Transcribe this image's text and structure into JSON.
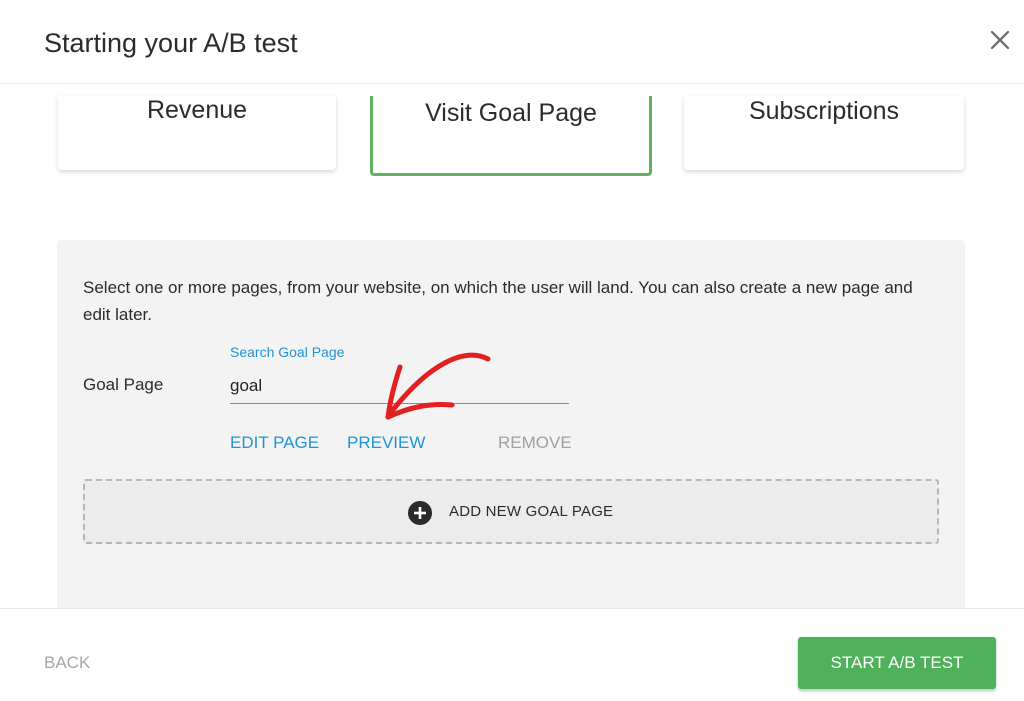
{
  "header": {
    "title": "Starting your A/B test",
    "close_icon": "close-icon"
  },
  "goal_types": [
    {
      "label": "Revenue",
      "selected": false
    },
    {
      "label": "Visit Goal Page",
      "selected": true
    },
    {
      "label": "Subscriptions",
      "selected": false
    }
  ],
  "panel": {
    "description": "Select one or more pages, from your website, on which the user will land. You can also create a new page and edit later.",
    "goal_page_label": "Goal Page",
    "search_label": "Search Goal Page",
    "search_value": "goal",
    "links": {
      "edit": "EDIT PAGE",
      "preview": "PREVIEW",
      "remove": "REMOVE"
    },
    "add_new": {
      "icon": "plus-circle-icon",
      "label": "ADD NEW GOAL PAGE"
    }
  },
  "footer": {
    "back_label": "BACK",
    "start_label": "START A/B TEST"
  },
  "colors": {
    "accent_green": "#4fb15a",
    "selected_border": "#5cb25f",
    "link_blue": "#1f95d6",
    "muted_gray": "#a0a0a0",
    "annotation_red": "#e32020"
  }
}
